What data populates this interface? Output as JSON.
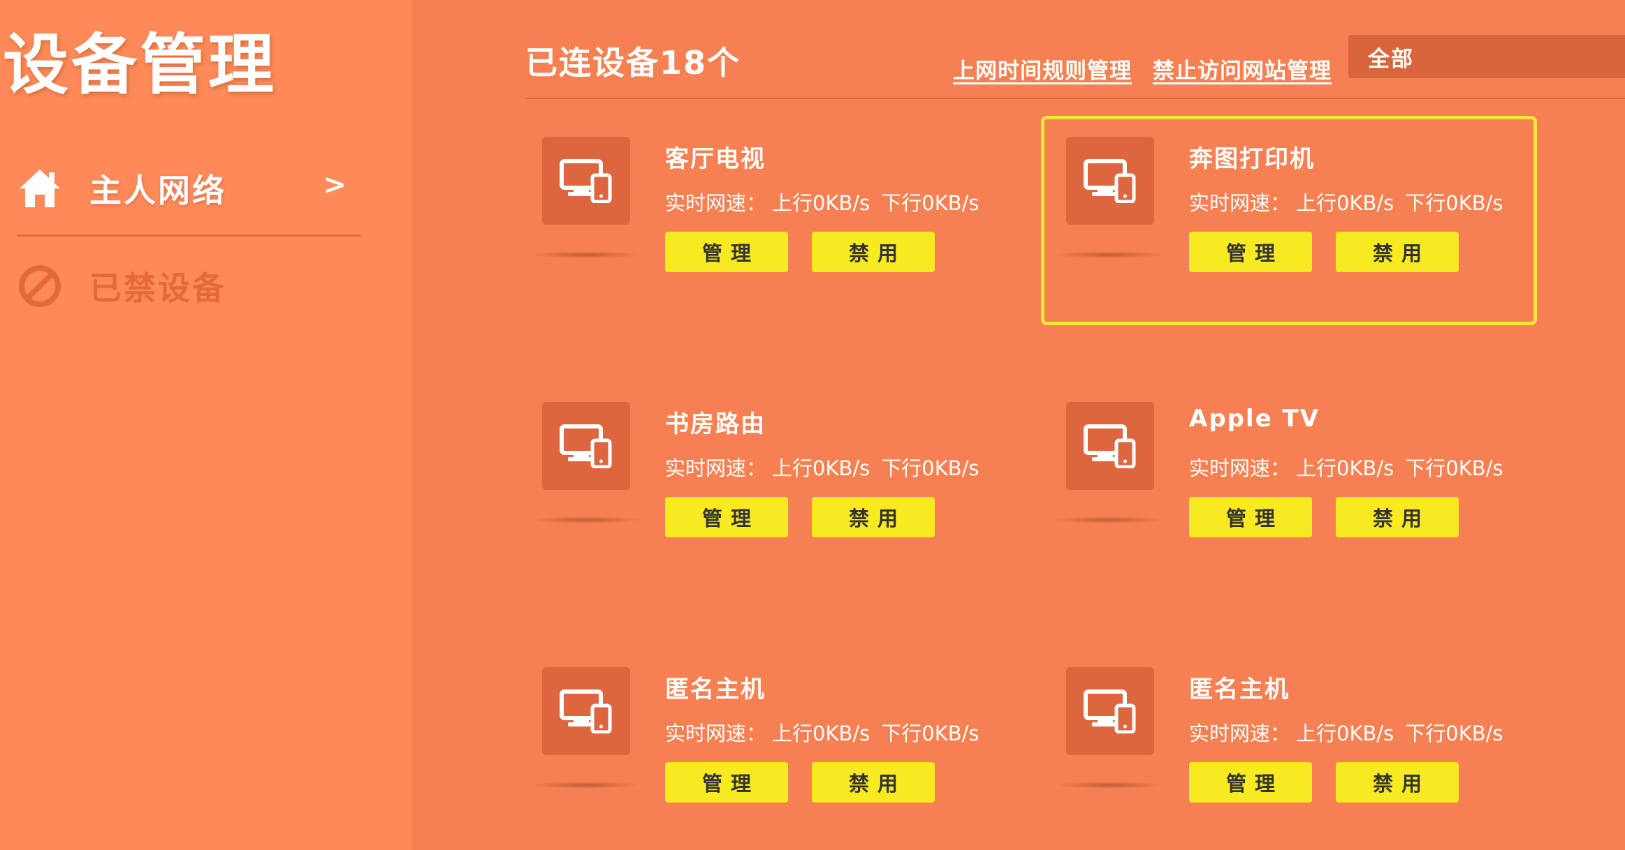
{
  "sidebar": {
    "title": "设备管理",
    "items": [
      {
        "label": "主人网络",
        "arrow": ">"
      },
      {
        "label": "已禁设备"
      }
    ]
  },
  "header": {
    "title": "已连设备18个",
    "link_rules": "上网时间规则管理",
    "link_sites": "禁止访问网站管理",
    "filter_value": "全部"
  },
  "speed": {
    "label": "实时网速：",
    "up": "上行0KB/s",
    "down": "下行0KB/s"
  },
  "buttons": {
    "manage": "管理",
    "block": "禁用"
  },
  "devices": [
    {
      "name": "客厅电视"
    },
    {
      "name": "奔图打印机",
      "selected": true
    },
    {
      "name": "书房路由"
    },
    {
      "name": "Apple TV"
    },
    {
      "name": "匿名主机"
    },
    {
      "name": "匿名主机"
    }
  ],
  "colors": {
    "sidebar_bg": "#FD8A58",
    "main_bg": "#F68051",
    "button_bg": "#F8EA21",
    "icon_bg": "#DD663E",
    "selection_border": "#F6E63A"
  },
  "icons": {
    "nav_home": "home-icon",
    "nav_blocked": "block-icon",
    "device": "device-monitor-phone-icon"
  }
}
